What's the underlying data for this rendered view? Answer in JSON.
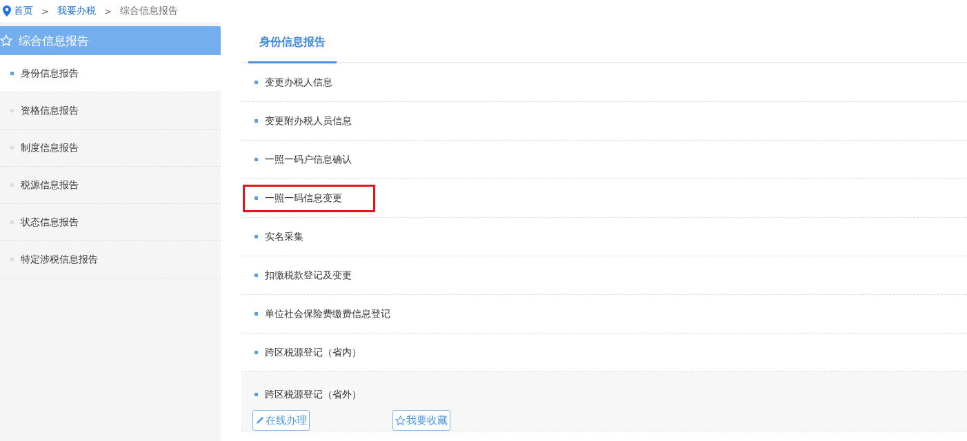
{
  "breadcrumb": [
    {
      "label": "首页",
      "kind": "link"
    },
    {
      "label": "我要办税",
      "kind": "link"
    },
    {
      "label": "综合信息报告",
      "kind": "current"
    }
  ],
  "breadcrumb_separator": ">",
  "sidebar": {
    "title": "综合信息报告",
    "items": [
      {
        "label": "身份信息报告",
        "selected": true
      },
      {
        "label": "资格信息报告",
        "selected": false
      },
      {
        "label": "制度信息报告",
        "selected": false
      },
      {
        "label": "税源信息报告",
        "selected": false
      },
      {
        "label": "状态信息报告",
        "selected": false
      },
      {
        "label": "特定涉税信息报告",
        "selected": false
      }
    ]
  },
  "tabs": [
    {
      "label": "身份信息报告",
      "selected": true
    }
  ],
  "items": [
    {
      "label": "变更办税人信息",
      "highlighted": false,
      "expanded": false
    },
    {
      "label": "变更附办税人员信息",
      "highlighted": false,
      "expanded": false
    },
    {
      "label": "一照一码户信息确认",
      "highlighted": false,
      "expanded": false
    },
    {
      "label": "一照一码信息变更",
      "highlighted": true,
      "expanded": false
    },
    {
      "label": "实名采集",
      "highlighted": false,
      "expanded": false
    },
    {
      "label": "扣缴税款登记及变更",
      "highlighted": false,
      "expanded": false
    },
    {
      "label": "单位社会保险费缴费信息登记",
      "highlighted": false,
      "expanded": false
    },
    {
      "label": "跨区税源登记（省内）",
      "highlighted": false,
      "expanded": false
    },
    {
      "label": "跨区税源登记（省外）",
      "highlighted": false,
      "expanded": true
    }
  ],
  "item_actions": [
    {
      "label": "在线办理",
      "kind": "edit"
    },
    {
      "label": "我要收藏",
      "kind": "favorite"
    }
  ]
}
